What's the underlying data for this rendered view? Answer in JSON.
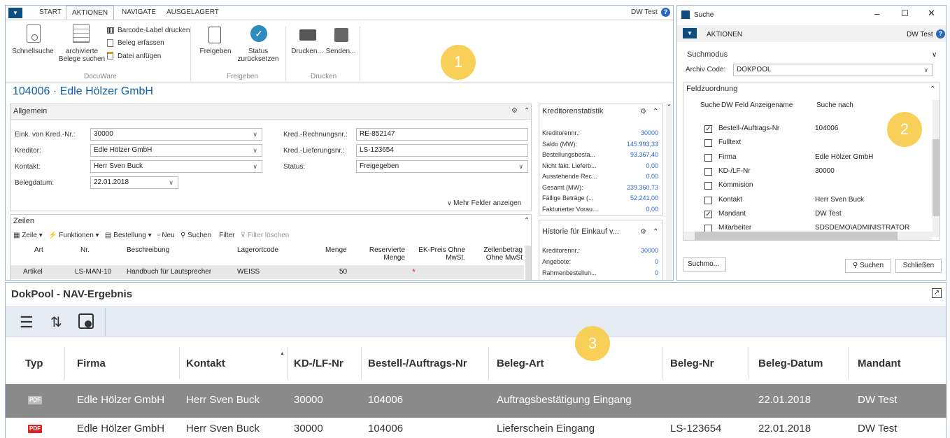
{
  "nav": {
    "tabs": [
      "START",
      "AKTIONEN",
      "NAVIGATE",
      "AUSGELAGERT"
    ],
    "right_label": "DW Test",
    "actions": {
      "schnellsuche": "Schnellsuche",
      "archivierte_1": "archivierte",
      "archivierte_2": "Belege suchen",
      "barcode": "Barcode-Label drucken",
      "beleg_erfassen": "Beleg erfassen",
      "datei_anfuegen": "Datei anfügen",
      "freigeben": "Freigeben",
      "status_1": "Status",
      "status_2": "zurücksetzen",
      "drucken": "Drucken...",
      "senden": "Senden..."
    },
    "groups": [
      "DocuWare",
      "Freigeben",
      "Drucken"
    ]
  },
  "page_title": "104006 · Edle Hölzer GmbH",
  "allgemein": {
    "title": "Allgemein",
    "fields": {
      "eink_label": "Eink. von Kred.-Nr.:",
      "eink_value": "30000",
      "kreditor_label": "Kreditor:",
      "kreditor_value": "Edle Hölzer GmbH",
      "kontakt_label": "Kontakt:",
      "kontakt_value": "Herr Sven Buck",
      "belegdatum_label": "Belegdatum:",
      "belegdatum_value": "22.01.2018",
      "rechnung_label": "Kred.-Rechnungsnr.:",
      "rechnung_value": "RE-852147",
      "liefer_label": "Kred.-Lieferungsnr.:",
      "liefer_value": "LS-123654",
      "status_label": "Status:",
      "status_value": "Freigegeben"
    },
    "mehr": "Mehr Felder anzeigen"
  },
  "zeilen": {
    "title": "Zeilen",
    "toolbar": [
      "Zeile",
      "Funktionen",
      "Bestellung",
      "Neu",
      "Suchen",
      "Filter",
      "Filter löschen"
    ],
    "headers": [
      "Art",
      "Nr.",
      "Beschreibung",
      "Lagerortcode",
      "Menge",
      "Reservierte Menge",
      "EK-Preis Ohne MwSt.",
      "Zeilenbetrag Ohne MwSt"
    ],
    "row": [
      "Artikel",
      "LS-MAN-10",
      "Handbuch für Lautsprecher",
      "WEISS",
      "50"
    ]
  },
  "kreditorenstatistik": {
    "title": "Kreditorenstatistik",
    "rows": [
      {
        "label": "Kreditorennr.:",
        "value": "30000"
      },
      {
        "label": "Saldo (MW):",
        "value": "145.993,33"
      },
      {
        "label": "Bestellungsbesta...",
        "value": "93.367,40"
      },
      {
        "label": "Nicht fakt. Lieferb...",
        "value": "0,00"
      },
      {
        "label": "Ausstehende Rec...",
        "value": "0,00"
      },
      {
        "label": "Gesamt (MW):",
        "value": "239.360,73"
      },
      {
        "label": "Fällige Beträge (...",
        "value": "52.241,00"
      },
      {
        "label": "Fakturierter Vorau...",
        "value": "0,00"
      }
    ]
  },
  "historie": {
    "title": "Historie für Einkauf v...",
    "rows": [
      {
        "label": "Kreditorennr.:",
        "value": "30000"
      },
      {
        "label": "Angebote:",
        "value": "0"
      },
      {
        "label": "Rahmenbestellun...",
        "value": "0"
      }
    ]
  },
  "suche": {
    "window_title": "Suche",
    "tab": "AKTIONEN",
    "right_label": "DW Test",
    "suchmodus": "Suchmodus",
    "archiv_label": "Archiv Code:",
    "archiv_value": "DOKPOOL",
    "feldzuordnung": "Feldzuordnung",
    "headers": [
      "Suche",
      "DW Feld Anzeigename",
      "Suche nach"
    ],
    "rows": [
      {
        "checked": true,
        "name": "Bestell-/Auftrags-Nr",
        "value": "104006"
      },
      {
        "checked": false,
        "name": "Fulltext",
        "value": ""
      },
      {
        "checked": false,
        "name": "Firma",
        "value": "Edle Hölzer GmbH"
      },
      {
        "checked": false,
        "name": "KD-/LF-Nr",
        "value": "30000"
      },
      {
        "checked": false,
        "name": "Kommision",
        "value": ""
      },
      {
        "checked": false,
        "name": "Kontakt",
        "value": "Herr Sven Buck"
      },
      {
        "checked": true,
        "name": "Mandant",
        "value": "DW Test"
      },
      {
        "checked": false,
        "name": "Mitarbeiter",
        "value": "SDSDEMO\\ADMINISTRATOR"
      }
    ],
    "suchmo_btn": "Suchmo...",
    "suchen_btn": "Suchen",
    "schliessen_btn": "Schließen"
  },
  "dokpool": {
    "title": "DokPool - NAV-Ergebnis",
    "headers": [
      "Typ",
      "Firma",
      "Kontakt",
      "KD-/LF-Nr",
      "Bestell-/Auftrags-Nr",
      "Beleg-Art",
      "Beleg-Nr",
      "Beleg-Datum",
      "Mandant"
    ],
    "rows": [
      [
        "PDF",
        "Edle Hölzer GmbH",
        "Herr Sven Buck",
        "30000",
        "104006",
        "Auftragsbestätigung Eingang",
        "",
        "22.01.2018",
        "DW Test"
      ],
      [
        "PDF",
        "Edle Hölzer GmbH",
        "Herr Sven Buck",
        "30000",
        "104006",
        "Lieferschein Eingang",
        "LS-123654",
        "22.01.2018",
        "DW Test"
      ]
    ]
  },
  "markers": [
    "1",
    "2",
    "3"
  ],
  "colors": {
    "navy": "#0f4c81",
    "accent": "#2a6ac1",
    "highlight": "#8a8a8a",
    "marker": "#f8cd4b",
    "pdf_red": "#d22"
  }
}
